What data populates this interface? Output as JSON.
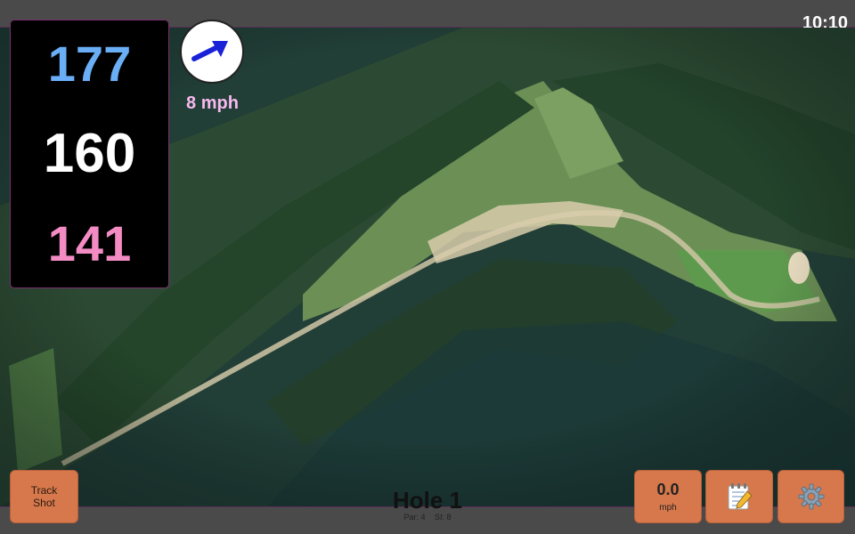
{
  "clock": "10:10",
  "distances": {
    "back": "177",
    "middle": "160",
    "front": "141"
  },
  "wind": {
    "speed_label": "8 mph",
    "icon": "wind-arrow-icon"
  },
  "buttons": {
    "track_shot_line1": "Track",
    "track_shot_line2": "Shot",
    "speed_value": "0.0",
    "speed_unit": "mph",
    "notes_icon": "notepad-icon",
    "settings_icon": "gear-icon"
  },
  "hole": {
    "title": "Hole 1",
    "par_label": "Par: 4",
    "si_label": "SI: 8"
  },
  "colors": {
    "back": "#6aaef5",
    "middle": "#ffffff",
    "front": "#f48cc4",
    "button": "#d6784b",
    "wind_text": "#f7b9ef",
    "frame_accent": "#7a2e6d"
  }
}
